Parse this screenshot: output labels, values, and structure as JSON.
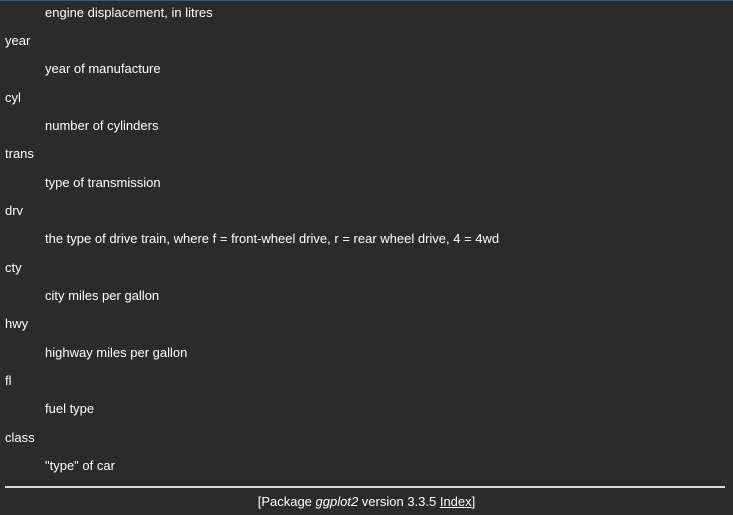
{
  "variables": [
    {
      "term": "",
      "description": "engine displacement, in litres"
    },
    {
      "term": "year",
      "description": "year of manufacture"
    },
    {
      "term": "cyl",
      "description": "number of cylinders"
    },
    {
      "term": "trans",
      "description": "type of transmission"
    },
    {
      "term": "drv",
      "description": "the type of drive train, where f = front-wheel drive, r = rear wheel drive, 4 = 4wd"
    },
    {
      "term": "cty",
      "description": "city miles per gallon"
    },
    {
      "term": "hwy",
      "description": "highway miles per gallon"
    },
    {
      "term": "fl",
      "description": "fuel type"
    },
    {
      "term": "class",
      "description": "\"type\" of car"
    }
  ],
  "footer": {
    "open": "[Package ",
    "package_name": "ggplot2",
    "version_text": " version 3.3.5 ",
    "index_link": "Index",
    "close": "]"
  }
}
